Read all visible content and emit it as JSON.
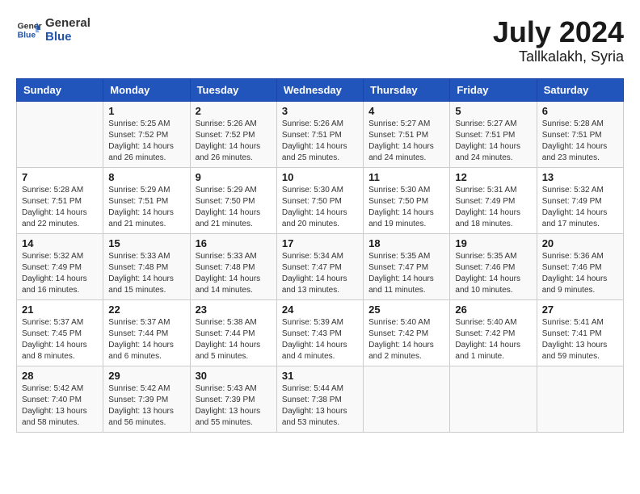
{
  "logo": {
    "text_general": "General",
    "text_blue": "Blue"
  },
  "title": "July 2024",
  "subtitle": "Tallkalakh, Syria",
  "days_of_week": [
    "Sunday",
    "Monday",
    "Tuesday",
    "Wednesday",
    "Thursday",
    "Friday",
    "Saturday"
  ],
  "weeks": [
    [
      {
        "day": "",
        "info": ""
      },
      {
        "day": "1",
        "info": "Sunrise: 5:25 AM\nSunset: 7:52 PM\nDaylight: 14 hours\nand 26 minutes."
      },
      {
        "day": "2",
        "info": "Sunrise: 5:26 AM\nSunset: 7:52 PM\nDaylight: 14 hours\nand 26 minutes."
      },
      {
        "day": "3",
        "info": "Sunrise: 5:26 AM\nSunset: 7:51 PM\nDaylight: 14 hours\nand 25 minutes."
      },
      {
        "day": "4",
        "info": "Sunrise: 5:27 AM\nSunset: 7:51 PM\nDaylight: 14 hours\nand 24 minutes."
      },
      {
        "day": "5",
        "info": "Sunrise: 5:27 AM\nSunset: 7:51 PM\nDaylight: 14 hours\nand 24 minutes."
      },
      {
        "day": "6",
        "info": "Sunrise: 5:28 AM\nSunset: 7:51 PM\nDaylight: 14 hours\nand 23 minutes."
      }
    ],
    [
      {
        "day": "7",
        "info": "Sunrise: 5:28 AM\nSunset: 7:51 PM\nDaylight: 14 hours\nand 22 minutes."
      },
      {
        "day": "8",
        "info": "Sunrise: 5:29 AM\nSunset: 7:51 PM\nDaylight: 14 hours\nand 21 minutes."
      },
      {
        "day": "9",
        "info": "Sunrise: 5:29 AM\nSunset: 7:50 PM\nDaylight: 14 hours\nand 21 minutes."
      },
      {
        "day": "10",
        "info": "Sunrise: 5:30 AM\nSunset: 7:50 PM\nDaylight: 14 hours\nand 20 minutes."
      },
      {
        "day": "11",
        "info": "Sunrise: 5:30 AM\nSunset: 7:50 PM\nDaylight: 14 hours\nand 19 minutes."
      },
      {
        "day": "12",
        "info": "Sunrise: 5:31 AM\nSunset: 7:49 PM\nDaylight: 14 hours\nand 18 minutes."
      },
      {
        "day": "13",
        "info": "Sunrise: 5:32 AM\nSunset: 7:49 PM\nDaylight: 14 hours\nand 17 minutes."
      }
    ],
    [
      {
        "day": "14",
        "info": "Sunrise: 5:32 AM\nSunset: 7:49 PM\nDaylight: 14 hours\nand 16 minutes."
      },
      {
        "day": "15",
        "info": "Sunrise: 5:33 AM\nSunset: 7:48 PM\nDaylight: 14 hours\nand 15 minutes."
      },
      {
        "day": "16",
        "info": "Sunrise: 5:33 AM\nSunset: 7:48 PM\nDaylight: 14 hours\nand 14 minutes."
      },
      {
        "day": "17",
        "info": "Sunrise: 5:34 AM\nSunset: 7:47 PM\nDaylight: 14 hours\nand 13 minutes."
      },
      {
        "day": "18",
        "info": "Sunrise: 5:35 AM\nSunset: 7:47 PM\nDaylight: 14 hours\nand 11 minutes."
      },
      {
        "day": "19",
        "info": "Sunrise: 5:35 AM\nSunset: 7:46 PM\nDaylight: 14 hours\nand 10 minutes."
      },
      {
        "day": "20",
        "info": "Sunrise: 5:36 AM\nSunset: 7:46 PM\nDaylight: 14 hours\nand 9 minutes."
      }
    ],
    [
      {
        "day": "21",
        "info": "Sunrise: 5:37 AM\nSunset: 7:45 PM\nDaylight: 14 hours\nand 8 minutes."
      },
      {
        "day": "22",
        "info": "Sunrise: 5:37 AM\nSunset: 7:44 PM\nDaylight: 14 hours\nand 6 minutes."
      },
      {
        "day": "23",
        "info": "Sunrise: 5:38 AM\nSunset: 7:44 PM\nDaylight: 14 hours\nand 5 minutes."
      },
      {
        "day": "24",
        "info": "Sunrise: 5:39 AM\nSunset: 7:43 PM\nDaylight: 14 hours\nand 4 minutes."
      },
      {
        "day": "25",
        "info": "Sunrise: 5:40 AM\nSunset: 7:42 PM\nDaylight: 14 hours\nand 2 minutes."
      },
      {
        "day": "26",
        "info": "Sunrise: 5:40 AM\nSunset: 7:42 PM\nDaylight: 14 hours\nand 1 minute."
      },
      {
        "day": "27",
        "info": "Sunrise: 5:41 AM\nSunset: 7:41 PM\nDaylight: 13 hours\nand 59 minutes."
      }
    ],
    [
      {
        "day": "28",
        "info": "Sunrise: 5:42 AM\nSunset: 7:40 PM\nDaylight: 13 hours\nand 58 minutes."
      },
      {
        "day": "29",
        "info": "Sunrise: 5:42 AM\nSunset: 7:39 PM\nDaylight: 13 hours\nand 56 minutes."
      },
      {
        "day": "30",
        "info": "Sunrise: 5:43 AM\nSunset: 7:39 PM\nDaylight: 13 hours\nand 55 minutes."
      },
      {
        "day": "31",
        "info": "Sunrise: 5:44 AM\nSunset: 7:38 PM\nDaylight: 13 hours\nand 53 minutes."
      },
      {
        "day": "",
        "info": ""
      },
      {
        "day": "",
        "info": ""
      },
      {
        "day": "",
        "info": ""
      }
    ]
  ]
}
